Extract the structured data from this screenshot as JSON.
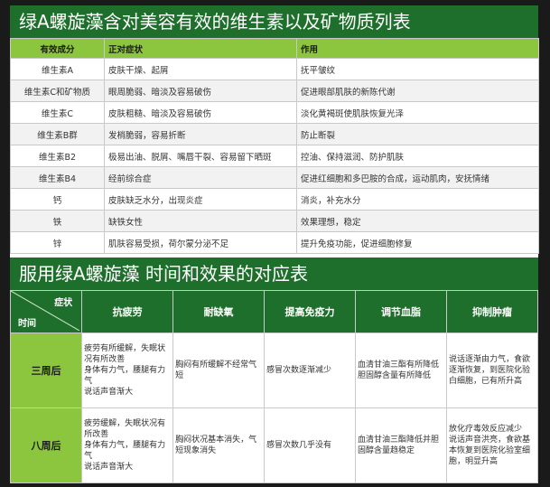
{
  "section1": {
    "title": "绿A螺旋藻含对美容有效的维生素以及矿物质列表",
    "headers": [
      "有效成分",
      "正对症状",
      "作用"
    ],
    "rows": [
      [
        "维生素A",
        "皮肤干燥、起屑",
        "抚平皱纹"
      ],
      [
        "维生素C和矿物质",
        "眼周脆弱、暗淡及容易破伤",
        "促进眼部肌肤的新陈代谢"
      ],
      [
        "维生素C",
        "皮肤粗糙、暗淡及容易破伤",
        "淡化黄褐斑使肌肤恢复光泽"
      ],
      [
        "维生素B群",
        "发梢脆弱，容易折断",
        "防止断裂"
      ],
      [
        "维生素B2",
        "极易出油、脱屑、嘴唇干裂、容易留下晒斑",
        "控油、保持滋润、防护肌肤"
      ],
      [
        "维生素B4",
        "经前综合症",
        "促进红细胞和多巴胺的合成，运动肌肉，安抚情绪"
      ],
      [
        "钙",
        "皮肤缺乏水分，出现炎症",
        "消炎，补充水分"
      ],
      [
        "铁",
        "缺铁女性",
        "效果理想，稳定"
      ],
      [
        "锌",
        "肌肤容易受损，荷尔蒙分泌不足",
        "提升免疫功能，促进细胞修复"
      ]
    ]
  },
  "section2": {
    "title": "服用绿A螺旋藻 时间和效果的对应表",
    "corner_top": "症状",
    "corner_bottom": "时间",
    "columns": [
      "抗疲劳",
      "耐缺氧",
      "提高免疫力",
      "调节血脂",
      "抑制肿瘤"
    ],
    "rows": [
      {
        "label": "三周后",
        "cells": [
          "疲劳有所缓解，失眠状况有所改善\n身体有力气，腰腿有力气\n说话声音渐大",
          "胸闷有所缓解不经常气短",
          "感冒次数逐渐减少",
          "血清甘油三酯有所降低胆固醇含量有所降低",
          "说话逐渐由力气，食欲逐渐恢复，到医院化验白细胞，已有所升高"
        ]
      },
      {
        "label": "八周后",
        "cells": [
          "疲劳缓解，失眠状况有所改善\n身体有力气，腰腿有力气\n说话声音渐大",
          "胸闷状况基本消失，气短现象消失",
          "感冒次数几乎没有",
          "血清甘油三酯降低并胆固醇含量趋稳定",
          "放化疗毒效反应减少\n说话声音洪亮，食欲基本恢复到医院化验室细胞，明显升高"
        ]
      }
    ]
  },
  "colors": {
    "band": "#1f6f2c",
    "header_green": "#8cc63f"
  }
}
